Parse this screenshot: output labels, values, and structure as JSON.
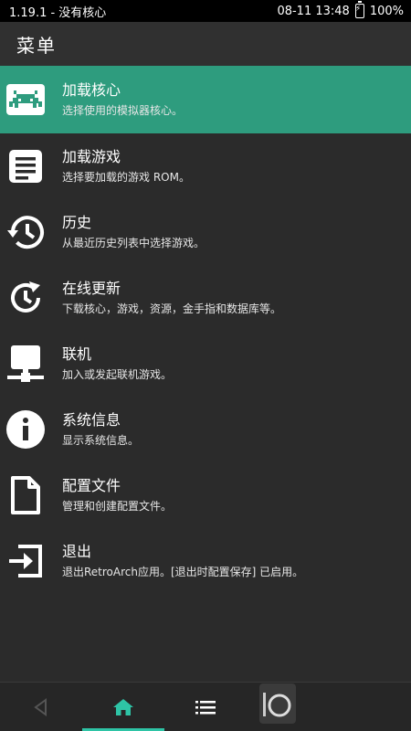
{
  "status_bar": {
    "left_text": "1.19.1 - 没有核心",
    "datetime": "08-11 13:48",
    "battery": "100%"
  },
  "header": {
    "title": "菜单"
  },
  "menu": {
    "items": [
      {
        "label": "加载核心",
        "sublabel": "选择使用的模拟器核心。",
        "icon": "invader-icon",
        "active": true
      },
      {
        "label": "加载游戏",
        "sublabel": "选择要加载的游戏 ROM。",
        "icon": "document-lines-icon",
        "active": false
      },
      {
        "label": "历史",
        "sublabel": "从最近历史列表中选择游戏。",
        "icon": "history-icon",
        "active": false
      },
      {
        "label": "在线更新",
        "sublabel": "下载核心，游戏，资源，金手指和数据库等。",
        "icon": "update-icon",
        "active": false
      },
      {
        "label": "联机",
        "sublabel": "加入或发起联机游戏。",
        "icon": "network-icon",
        "active": false
      },
      {
        "label": "系统信息",
        "sublabel": "显示系统信息。",
        "icon": "info-icon",
        "active": false
      },
      {
        "label": "配置文件",
        "sublabel": "管理和创建配置文件。",
        "icon": "file-icon",
        "active": false
      },
      {
        "label": "退出",
        "sublabel": "退出RetroArch应用。[退出时配置保存] 已启用。",
        "icon": "exit-icon",
        "active": false
      }
    ]
  },
  "bottom_nav": {
    "items": [
      "back-icon",
      "home-icon",
      "list-icon"
    ],
    "selected": "home-icon"
  },
  "colors": {
    "accent": "#2e9c7e",
    "indicator": "#2ec4a6",
    "background": "#2b2b2b"
  }
}
